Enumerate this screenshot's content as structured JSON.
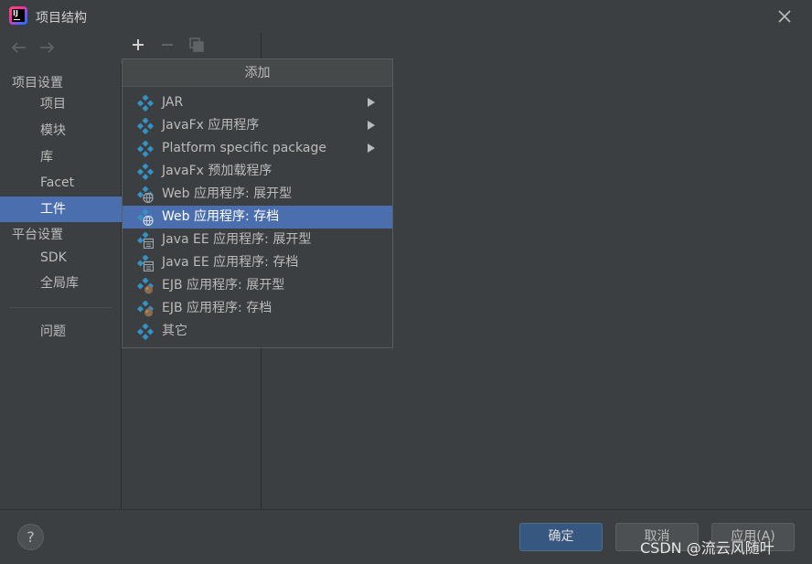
{
  "window": {
    "title": "项目结构"
  },
  "sidebar": {
    "header_project_settings": "项目设置",
    "header_platform_settings": "平台设置",
    "items": [
      {
        "label": "项目"
      },
      {
        "label": "模块"
      },
      {
        "label": "库"
      },
      {
        "label": "Facet"
      },
      {
        "label": "工件",
        "selected": true
      },
      {
        "label": "SDK"
      },
      {
        "label": "全局库"
      },
      {
        "label": "问题"
      }
    ]
  },
  "popup": {
    "title": "添加",
    "items": [
      {
        "label": "JAR",
        "icon": "module-icon",
        "submenu": true
      },
      {
        "label": "JavaFx 应用程序",
        "icon": "module-icon",
        "submenu": true
      },
      {
        "label": "Platform specific package",
        "icon": "module-icon",
        "submenu": true
      },
      {
        "label": "JavaFx 预加载程序",
        "icon": "module-icon",
        "submenu": false
      },
      {
        "label": "Web 应用程序: 展开型",
        "icon": "web-module-icon",
        "submenu": false
      },
      {
        "label": "Web 应用程序: 存档",
        "icon": "web-module-icon",
        "submenu": false,
        "highlighted": true
      },
      {
        "label": "Java EE 应用程序: 展开型",
        "icon": "javaee-module-icon",
        "submenu": false
      },
      {
        "label": "Java EE 应用程序: 存档",
        "icon": "javaee-module-icon",
        "submenu": false
      },
      {
        "label": "EJB 应用程序: 展开型",
        "icon": "ejb-module-icon",
        "submenu": false
      },
      {
        "label": "EJB 应用程序: 存档",
        "icon": "ejb-module-icon",
        "submenu": false
      },
      {
        "label": "其它",
        "icon": "module-icon",
        "submenu": false
      }
    ]
  },
  "buttons": {
    "help": "?",
    "ok": "确定",
    "cancel": "取消",
    "apply": "应用(A)"
  },
  "watermark": "CSDN @流云风随叶",
  "colors": {
    "selection": "#4b6eaf",
    "background": "#3c3f41",
    "icon_blue": "#3592c4"
  }
}
